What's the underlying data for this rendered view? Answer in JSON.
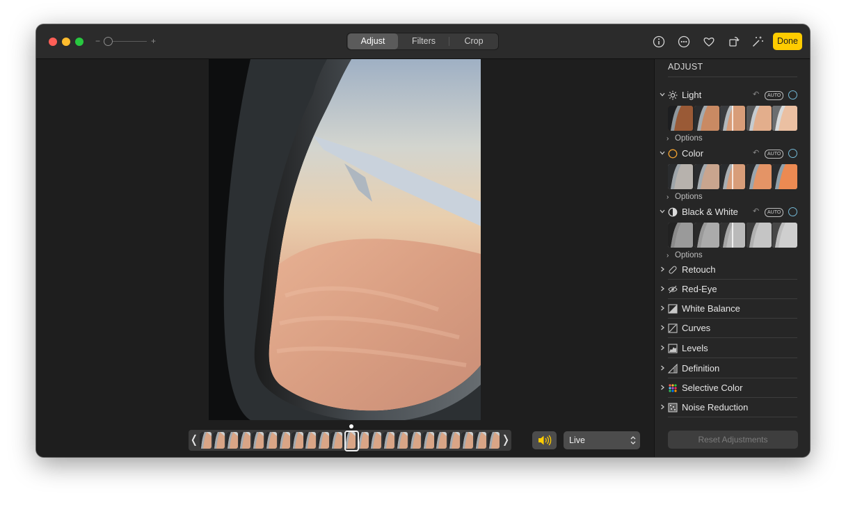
{
  "toolbar": {
    "zoom_minus": "−",
    "zoom_plus": "+",
    "tabs": [
      {
        "label": "Adjust",
        "selected": true
      },
      {
        "label": "Filters",
        "selected": false
      },
      {
        "label": "Crop",
        "selected": false
      }
    ],
    "icons": [
      "info-icon",
      "more-icon",
      "heart-icon",
      "rotate-icon",
      "magic-wand-icon"
    ],
    "done_label": "Done",
    "accent_color": "#ffcc00"
  },
  "scrubber": {
    "left_arrow": "❬",
    "right_arrow": "❭",
    "frame_count": 23,
    "selected_frame": 11
  },
  "playback": {
    "volume_icon": "speaker-icon",
    "mode_label": "Live"
  },
  "sidebar": {
    "header": "ADJUST",
    "sections": [
      {
        "label": "Light",
        "icon": "sun-icon",
        "options_label": "Options",
        "auto_label": "AUTO"
      },
      {
        "label": "Color",
        "icon": "color-circle-icon",
        "options_label": "Options",
        "auto_label": "AUTO"
      },
      {
        "label": "Black & White",
        "icon": "half-circle-icon",
        "options_label": "Options",
        "auto_label": "AUTO"
      }
    ],
    "tools": [
      {
        "label": "Retouch",
        "icon": "bandage-icon"
      },
      {
        "label": "Red-Eye",
        "icon": "eye-icon"
      },
      {
        "label": "White Balance",
        "icon": "white-balance-icon"
      },
      {
        "label": "Curves",
        "icon": "curves-icon"
      },
      {
        "label": "Levels",
        "icon": "levels-icon"
      },
      {
        "label": "Definition",
        "icon": "definition-icon"
      },
      {
        "label": "Selective Color",
        "icon": "selective-color-icon"
      },
      {
        "label": "Noise Reduction",
        "icon": "noise-reduction-icon"
      }
    ],
    "reset_label": "Reset Adjustments"
  }
}
